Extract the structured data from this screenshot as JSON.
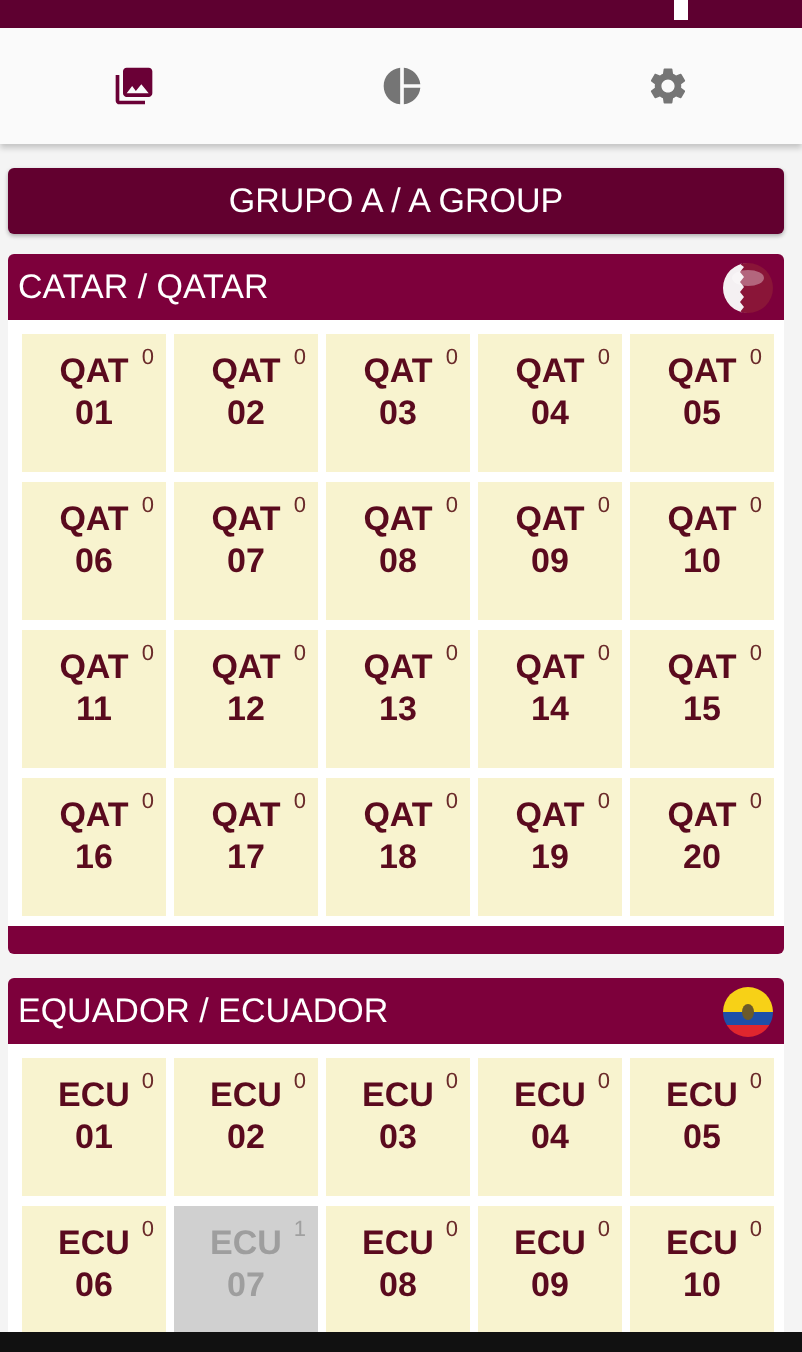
{
  "tabs": [
    {
      "kind": "album",
      "selected": true
    },
    {
      "kind": "stats",
      "selected": false
    },
    {
      "kind": "settings",
      "selected": false
    }
  ],
  "group_button": {
    "label": "GRUPO A / A GROUP"
  },
  "teams": [
    {
      "name": "CATAR / QATAR",
      "kind": "qatar",
      "stickers": [
        {
          "code": "QAT",
          "number": "01",
          "count": "0",
          "collected": false
        },
        {
          "code": "QAT",
          "number": "02",
          "count": "0",
          "collected": false
        },
        {
          "code": "QAT",
          "number": "03",
          "count": "0",
          "collected": false
        },
        {
          "code": "QAT",
          "number": "04",
          "count": "0",
          "collected": false
        },
        {
          "code": "QAT",
          "number": "05",
          "count": "0",
          "collected": false
        },
        {
          "code": "QAT",
          "number": "06",
          "count": "0",
          "collected": false
        },
        {
          "code": "QAT",
          "number": "07",
          "count": "0",
          "collected": false
        },
        {
          "code": "QAT",
          "number": "08",
          "count": "0",
          "collected": false
        },
        {
          "code": "QAT",
          "number": "09",
          "count": "0",
          "collected": false
        },
        {
          "code": "QAT",
          "number": "10",
          "count": "0",
          "collected": false
        },
        {
          "code": "QAT",
          "number": "11",
          "count": "0",
          "collected": false
        },
        {
          "code": "QAT",
          "number": "12",
          "count": "0",
          "collected": false
        },
        {
          "code": "QAT",
          "number": "13",
          "count": "0",
          "collected": false
        },
        {
          "code": "QAT",
          "number": "14",
          "count": "0",
          "collected": false
        },
        {
          "code": "QAT",
          "number": "15",
          "count": "0",
          "collected": false
        },
        {
          "code": "QAT",
          "number": "16",
          "count": "0",
          "collected": false
        },
        {
          "code": "QAT",
          "number": "17",
          "count": "0",
          "collected": false
        },
        {
          "code": "QAT",
          "number": "18",
          "count": "0",
          "collected": false
        },
        {
          "code": "QAT",
          "number": "19",
          "count": "0",
          "collected": false
        },
        {
          "code": "QAT",
          "number": "20",
          "count": "0",
          "collected": false
        }
      ]
    },
    {
      "name": "EQUADOR / ECUADOR",
      "kind": "ecuador",
      "stickers": [
        {
          "code": "ECU",
          "number": "01",
          "count": "0",
          "collected": false
        },
        {
          "code": "ECU",
          "number": "02",
          "count": "0",
          "collected": false
        },
        {
          "code": "ECU",
          "number": "03",
          "count": "0",
          "collected": false
        },
        {
          "code": "ECU",
          "number": "04",
          "count": "0",
          "collected": false
        },
        {
          "code": "ECU",
          "number": "05",
          "count": "0",
          "collected": false
        },
        {
          "code": "ECU",
          "number": "06",
          "count": "0",
          "collected": false
        },
        {
          "code": "ECU",
          "number": "07",
          "count": "1",
          "collected": true
        },
        {
          "code": "ECU",
          "number": "08",
          "count": "0",
          "collected": false
        },
        {
          "code": "ECU",
          "number": "09",
          "count": "0",
          "collected": false
        },
        {
          "code": "ECU",
          "number": "10",
          "count": "0",
          "collected": false
        }
      ]
    }
  ]
}
